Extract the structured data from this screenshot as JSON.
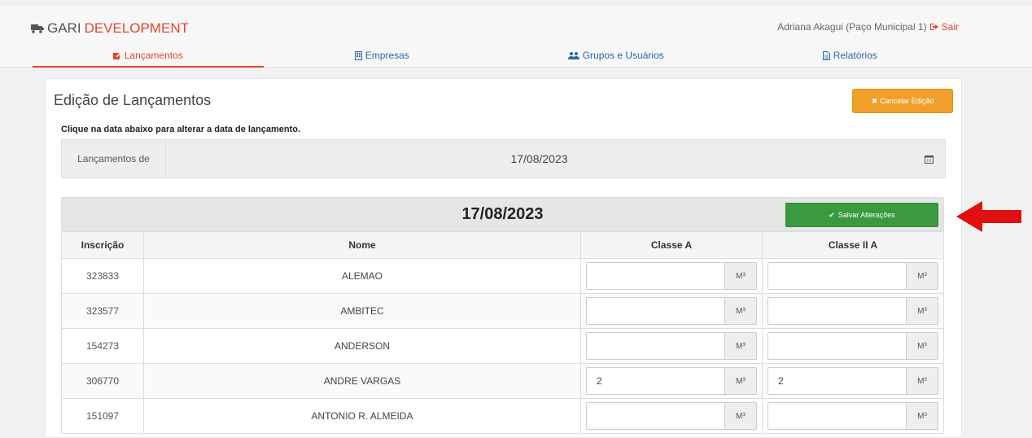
{
  "header": {
    "brand_prefix": "GARI",
    "brand_suffix": "DEVELOPMENT",
    "user": "Adriana Akagui (Paço Municipal 1)",
    "logout": "Sair"
  },
  "nav": [
    {
      "label": "Lançamentos",
      "icon": "edit-icon",
      "active": true
    },
    {
      "label": "Empresas",
      "icon": "building-icon",
      "active": false
    },
    {
      "label": "Grupos e Usuários",
      "icon": "users-icon",
      "active": false
    },
    {
      "label": "Relatórios",
      "icon": "report-icon",
      "active": false
    }
  ],
  "main": {
    "title": "Edição de Lançamentos",
    "cancel_label": "Cancelar Edição",
    "hint": "Clique na data abaixo para alterar a data de lançamento.",
    "date_label": "Lançamentos de",
    "date_value": "17/08/2023"
  },
  "table": {
    "date": "17/08/2023",
    "save_label": "Salvar Alterações",
    "headers": [
      "Inscrição",
      "Nome",
      "Classe A",
      "Classe II A"
    ],
    "unit": "M³",
    "rows": [
      {
        "insc": "323833",
        "nome": "ALEMAO",
        "a": "",
        "b": ""
      },
      {
        "insc": "323577",
        "nome": "AMBITEC",
        "a": "",
        "b": ""
      },
      {
        "insc": "154273",
        "nome": "ANDERSON",
        "a": "",
        "b": ""
      },
      {
        "insc": "306770",
        "nome": "ANDRE VARGAS",
        "a": "2",
        "b": "2"
      },
      {
        "insc": "151097",
        "nome": "ANTONIO R. ALMEIDA",
        "a": "",
        "b": ""
      }
    ]
  },
  "colors": {
    "accent": "#e8442f",
    "save": "#3b9a3f",
    "cancel": "#f0a02a",
    "link": "#2a66b0"
  }
}
